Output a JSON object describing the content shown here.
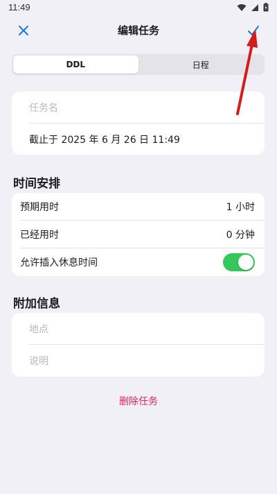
{
  "status_bar": {
    "time": "11:49"
  },
  "header": {
    "title": "编辑任务",
    "close_icon": "close-icon",
    "confirm_icon": "checkmark-icon"
  },
  "tabs": [
    {
      "label": "DDL",
      "active": true
    },
    {
      "label": "日程",
      "active": false
    }
  ],
  "task": {
    "name_placeholder": "任务名",
    "deadline": "截止于 2025 年 6 月 26 日 11:49"
  },
  "time_section": {
    "title": "时间安排",
    "rows": [
      {
        "label": "预期用时",
        "value": "1 小时"
      },
      {
        "label": "已经用时",
        "value": "0 分钟"
      }
    ],
    "break_toggle_label": "允许插入休息时间",
    "break_toggle_on": true
  },
  "extra_section": {
    "title": "附加信息",
    "location_placeholder": "地点",
    "description_placeholder": "说明"
  },
  "delete_label": "删除任务",
  "colors": {
    "accent": "#1a73e8",
    "toggle_on": "#34c759",
    "danger": "#e0245e",
    "annotation_arrow": "#d41c1c"
  }
}
